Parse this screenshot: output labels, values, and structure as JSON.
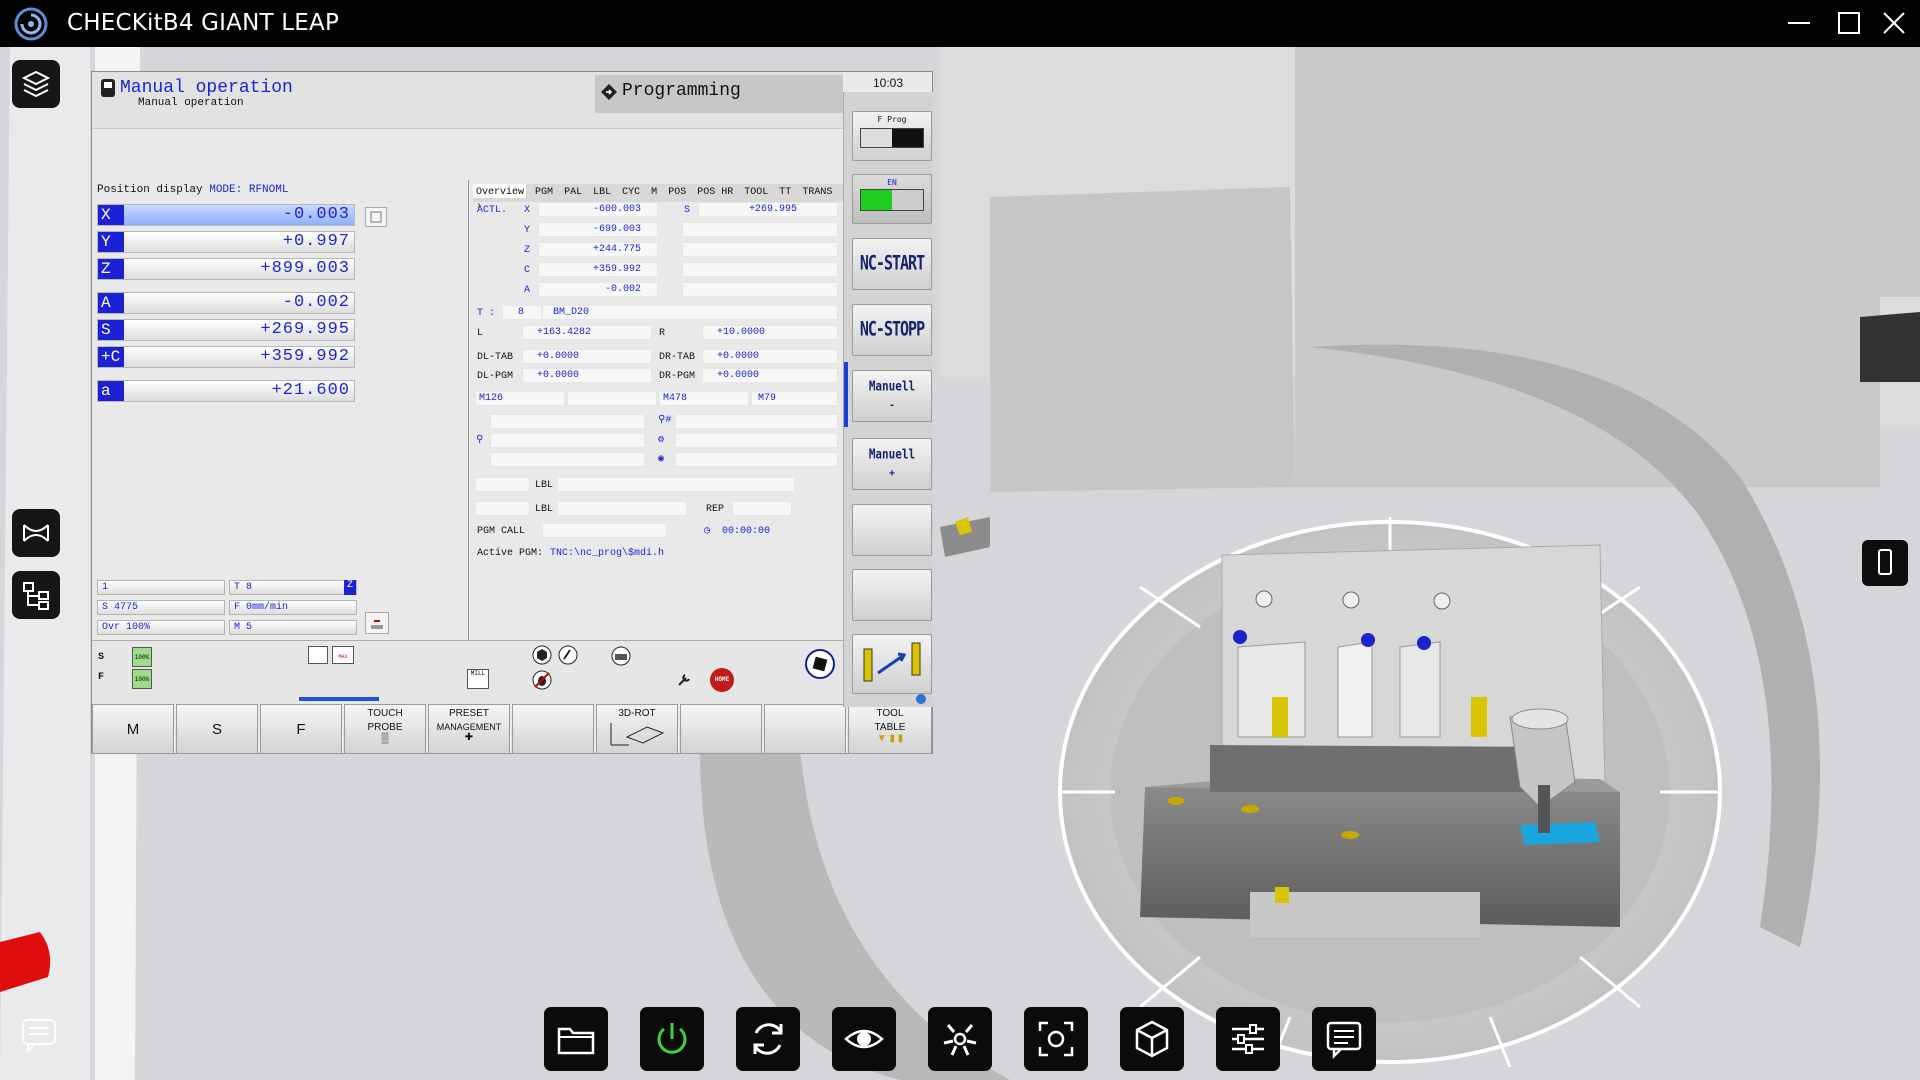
{
  "window": {
    "title": "CHECKitB4 GIANT LEAP"
  },
  "cnc": {
    "mode_title": "Manual operation",
    "mode_subtitle": "Manual operation",
    "programming_label": "Programming",
    "clock": "10:03",
    "position_display": {
      "label": "Position display",
      "mode_label": "MODE: RFNOML",
      "axes": [
        {
          "name": "X",
          "value": "-0.003"
        },
        {
          "name": "Y",
          "value": "+0.997"
        },
        {
          "name": "Z",
          "value": "+899.003"
        },
        {
          "name": "A",
          "value": "-0.002"
        },
        {
          "name": "S",
          "value": "+269.995"
        },
        {
          "name": "+C",
          "value": "+359.992"
        },
        {
          "name": "a",
          "value": "+21.600"
        }
      ],
      "status": {
        "spindle_slot": "1",
        "tool": "T 8",
        "tool_axis": "Z",
        "speed": "S 4775",
        "feed": "F 0mm/min",
        "override": "Ovr 100%",
        "m_function": "M 5"
      }
    },
    "overview": {
      "tabs": [
        "Overview",
        "PGM",
        "PAL",
        "LBL",
        "CYC",
        "M",
        "POS",
        "POS HR",
        "TOOL",
        "TT",
        "TRANS"
      ],
      "actl_label": "ACTL.",
      "actl": [
        {
          "axis": "X",
          "value": "-600.003"
        },
        {
          "axis": "Y",
          "value": "-699.003"
        },
        {
          "axis": "Z",
          "value": "+244.775"
        },
        {
          "axis": "C",
          "value": "+359.992"
        },
        {
          "axis": "A",
          "value": "-0.002"
        }
      ],
      "s_label": "S",
      "s_value": "+269.995",
      "t_label": "T :",
      "t_number": "8",
      "tool_name": "BM_D20",
      "l_label": "L",
      "l_value": "+163.4282",
      "r_label": "R",
      "r_value": "+10.0000",
      "dl_tab_label": "DL-TAB",
      "dl_tab_value": "+0.0000",
      "dr_tab_label": "DR-TAB",
      "dr_tab_value": "+0.0000",
      "dl_pgm_label": "DL-PGM",
      "dl_pgm_value": "+0.0000",
      "dr_pgm_label": "DR-PGM",
      "dr_pgm_value": "+0.0000",
      "m126": "M126",
      "m478": "M478",
      "m79": "M79",
      "lbl1": "LBL",
      "lbl2": "LBL",
      "rep": "REP",
      "pgm_call_label": "PGM CALL",
      "timer": "00:00:00",
      "active_pgm_label": "Active PGM:",
      "active_pgm_value": "TNC:\\nc_prog\\$mdi.h"
    },
    "side_buttons": {
      "fprog": "F Prog",
      "en": "EN",
      "nc_start": "NC-START",
      "nc_stopp": "NC-STOPP",
      "manuell_minus": "Manuell",
      "manuell_minus_sign": "-",
      "manuell_plus": "Manuell",
      "manuell_plus_sign": "+"
    },
    "overrides": {
      "s_label": "S",
      "f_label": "F",
      "s_pct": "100%",
      "f_pct": "100%"
    },
    "soft_keys": {
      "m": "M",
      "s": "S",
      "f": "F",
      "touch_probe_1": "TOUCH",
      "touch_probe_2": "PROBE",
      "preset_1": "PRESET",
      "preset_2": "MANAGEMENT",
      "rot_3d": "3D-ROT",
      "tool_table_1": "TOOL",
      "tool_table_2": "TABLE"
    },
    "icon_labels": {
      "mill": "MILL",
      "home": "HOME",
      "max": "MAX"
    }
  },
  "toolbar": {
    "buttons": [
      "folder-icon",
      "power-icon",
      "reset-icon",
      "view-icon",
      "explode-icon",
      "screenshot-icon",
      "cube-icon",
      "settings-icon",
      "notes-icon"
    ]
  },
  "colors": {
    "title_bar": "#020202",
    "cnc_blue": "#1a24d8",
    "toolbar_bg": "#0b0b0b",
    "power_green": "#3ed23e"
  }
}
